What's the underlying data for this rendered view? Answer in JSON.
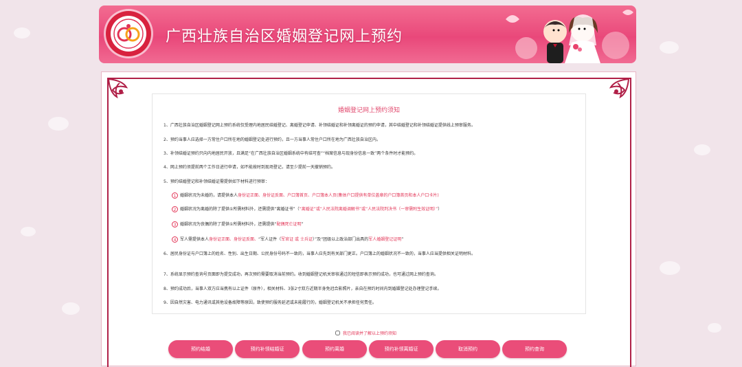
{
  "header": {
    "logo_text": "婚姻登记",
    "title": "广西壮族自治区婚姻登记网上预约"
  },
  "notice": {
    "title": "婚姻登记网上预约须知",
    "items": [
      "1、广西壮族自治区婚姻登记网上预约系统仅受理内地居民结婚登记、离婚登记申请、补领结婚证和补领离婚证的预约申请，其中结婚登记和补领结婚证提供线上预审服务。",
      "2、预约当事人应选择一方常住户口所在地的婚姻登记处进行预约，且一方当事人常住户口所在地为广西壮族自治区内。",
      "3、补领结婚证预约只向内地居民开放，且满足“在广西壮族自治区婚姻系统中有结可查”“档案信息与现身份信息一致”两个条件时才能预约。",
      "4、网上预约须提前两个工作日进行申请，如不能按时到现场登记，请至少提前一天撤销预约。",
      "5、预约结婚登记和补领结婚证需提供如下材料进行预审："
    ],
    "sub_items": [
      {
        "num": "1",
        "text_a": "婚姻状况为未婚的，请提供本人",
        "red_a": "身份证正面、身份证反面、户口簿首页、户口簿本人页(集体户口提供有单位盖章的户口簿首页和本人户口卡片)"
      },
      {
        "num": "2",
        "text_a": "婚姻状况为离婚的除了提供①所需材料外，还需提供“离婚证书”（",
        "red_a": "“离婚证”或“人民法院离婚调解书”或“人民法院判决书（一审需附生效证明）”",
        "text_b": "）"
      },
      {
        "num": "3",
        "text_a": "婚姻状况为丧偶的除了提供①所需材料外，还需提供“",
        "red_a": "配偶死亡证明",
        "text_b": "”"
      },
      {
        "num": "4",
        "text_a": "军人需提供本人",
        "red_a": "身份证正面、身份证反面、",
        "text_b": "“军人证件（",
        "red_b": "军官证 或 士兵证",
        "text_c": "）”及“团级以上政治部门出具的",
        "red_c": "军人婚姻登记证明",
        "text_d": "”"
      }
    ],
    "items_after": [
      "6、居民身份证与户口簿上的姓名、性别、出生日期、公民身份号码不一致的，当事人应先到有关部门更正。户口簿上的婚姻状况不一致的，当事人应当提供相关证明材料。",
      "7、系统显示预约查询号页面即为提交成功，再次预约需要取消当前预约。收到婚姻登记机关审核通过的短信即表示预约成功，也可通过网上预约查询。",
      "8、预约成功后，当事人双方应当携有以上证件（原件），相关材料、3张2寸双方近期半身免冠合影照片，亲自在预约时间内到婚姻登记处办理登记手续。",
      "9、因自然灾害、电力通讯或其他设备故障等原因，致使预约服务延迟或未能履行的，婚姻登记机关不承担任何责任。"
    ]
  },
  "agree": {
    "label": "我已阅读并了解以上预约须知"
  },
  "buttons": [
    "预约结婚",
    "预约补领结婚证",
    "预约离婚",
    "预约补领离婚证",
    "取消预约",
    "预约查询"
  ],
  "colors": {
    "accent": "#ea4d79",
    "frame": "#b01f47",
    "highlight": "#e23355"
  }
}
